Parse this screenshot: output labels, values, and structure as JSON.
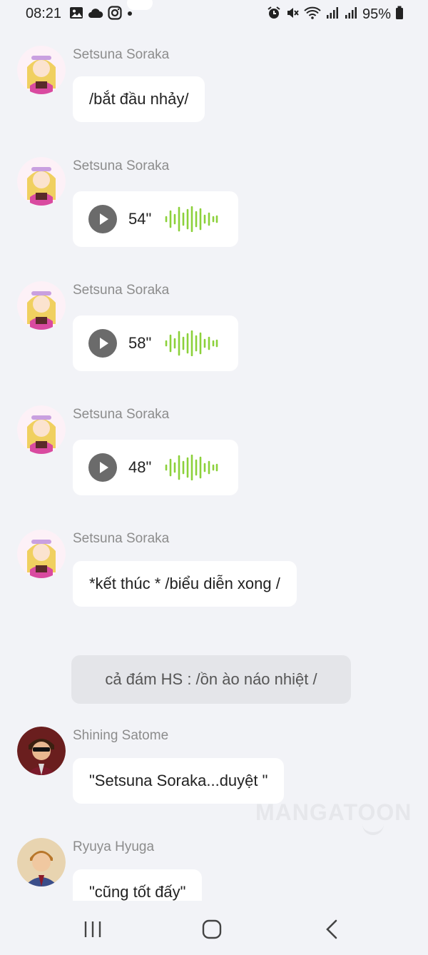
{
  "status_bar": {
    "time": "08:21",
    "battery_percent": "95%",
    "left_icons": [
      "gallery-icon",
      "cloud-icon",
      "instagram-icon",
      "dot-icon"
    ],
    "right_icons": [
      "alarm-icon",
      "mute-icon",
      "wifi-icon",
      "signal-icon",
      "signal-icon",
      "battery-icon"
    ]
  },
  "messages": [
    {
      "sender": "Setsuna Soraka",
      "type": "text",
      "text": "/bắt đầu nhảy/"
    },
    {
      "sender": "Setsuna Soraka",
      "type": "voice",
      "duration": "54\""
    },
    {
      "sender": "Setsuna Soraka",
      "type": "voice",
      "duration": "58\""
    },
    {
      "sender": "Setsuna Soraka",
      "type": "voice",
      "duration": "48\""
    },
    {
      "sender": "Setsuna Soraka",
      "type": "text",
      "text": "*kết thúc * /biểu diễn xong /"
    },
    {
      "sender": "Shining Satome",
      "type": "text",
      "text": "\"Setsuna Soraka...duyệt \""
    },
    {
      "sender": "Ryuya Hyuga",
      "type": "text",
      "text": "\"cũng tốt đấy\""
    }
  ],
  "narration": "cả đám HS : /ồn ào náo nhiệt /",
  "watermark": "MANGATOON",
  "colors": {
    "background": "#f2f3f7",
    "bubble": "#ffffff",
    "narration_bubble": "#e4e5e9",
    "waveform": "#8cd13a",
    "play_button": "#6b6b6b",
    "sender_name": "#8c8c8c"
  },
  "nav": {
    "icons": [
      "recent-apps-icon",
      "home-icon",
      "back-icon"
    ]
  }
}
